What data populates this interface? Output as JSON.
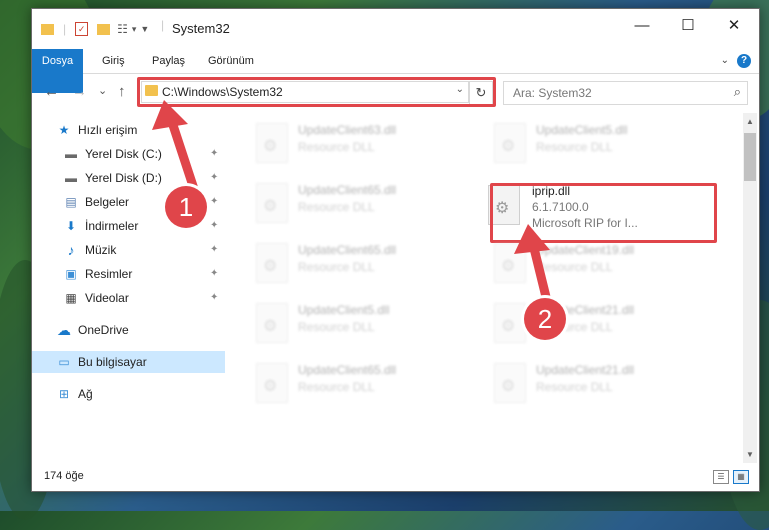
{
  "window": {
    "title": "System32",
    "minimize_glyph": "—",
    "maximize_glyph": "☐",
    "close_glyph": "✕"
  },
  "ribbon": {
    "tabs": [
      "Dosya",
      "Giriş",
      "Paylaş",
      "Görünüm"
    ],
    "help_glyph": "?",
    "expand_glyph": "⌄"
  },
  "nav": {
    "back_glyph": "←",
    "forward_glyph": "→",
    "recent_glyph": "⌄",
    "up_glyph": "↑",
    "address": "C:\\Windows\\System32",
    "address_dropdown_glyph": "⌄",
    "refresh_glyph": "↻",
    "search_placeholder": "Ara: System32",
    "search_glyph": "⌕"
  },
  "sidebar": {
    "items": [
      {
        "label": "Hızlı erişim",
        "icon": "star-icon",
        "glyph": "★",
        "color": "#1979ca"
      },
      {
        "label": "Yerel Disk (C:)",
        "icon": "drive-icon",
        "glyph": "▬",
        "color": "#6a6a6a",
        "pinned": true
      },
      {
        "label": "Yerel Disk (D:)",
        "icon": "drive-icon",
        "glyph": "▬",
        "color": "#6a6a6a",
        "pinned": true
      },
      {
        "label": "Belgeler",
        "icon": "document-icon",
        "glyph": "▤",
        "color": "#5a7fb0",
        "pinned": true
      },
      {
        "label": "İndirmeler",
        "icon": "download-icon",
        "glyph": "⬇",
        "color": "#1979ca",
        "pinned": true
      },
      {
        "label": "Müzik",
        "icon": "music-icon",
        "glyph": "♪",
        "color": "#1979ca",
        "pinned": true
      },
      {
        "label": "Resimler",
        "icon": "pictures-icon",
        "glyph": "▣",
        "color": "#3d8fd6",
        "pinned": true
      },
      {
        "label": "Videolar",
        "icon": "video-icon",
        "glyph": "▦",
        "color": "#444",
        "pinned": true
      },
      {
        "label": "OneDrive",
        "icon": "cloud-icon",
        "glyph": "☁",
        "color": "#1979ca"
      },
      {
        "label": "Bu bilgisayar",
        "icon": "computer-icon",
        "glyph": "▭",
        "color": "#3d8fd6",
        "selected": true
      },
      {
        "label": "Ağ",
        "icon": "network-icon",
        "glyph": "⊞",
        "color": "#3d8fd6"
      }
    ],
    "pin_glyph": "📌"
  },
  "files": {
    "highlighted": {
      "name": "iprip.dll",
      "version": "6.1.7100.0",
      "description": "Microsoft RIP for I..."
    },
    "left_column": [
      {
        "name": "UpdateClient63.dll",
        "type": "Resource DLL"
      },
      {
        "name": "UpdateClient65.dll",
        "type": "Resource DLL"
      },
      {
        "name": "UpdateClient65.dll",
        "type": "Resource DLL"
      },
      {
        "name": "UpdateClient5.dll",
        "type": "Resource DLL"
      },
      {
        "name": "UpdateClient65.dll",
        "type": "Resource DLL"
      }
    ],
    "right_column": [
      {
        "name": "UpdateClient5.dll",
        "type": "Resource DLL"
      },
      {
        "name": "UpdateClient19.dll",
        "type": "Resource DLL"
      },
      {
        "name": "UpdateClient21.dll",
        "type": "Resource DLL"
      },
      {
        "name": "UpdateClient21.dll",
        "type": "Resource DLL"
      }
    ]
  },
  "status": {
    "item_count": "174 öğe"
  },
  "annotations": {
    "step1": "1",
    "step2": "2",
    "accent": "#e0454a"
  }
}
